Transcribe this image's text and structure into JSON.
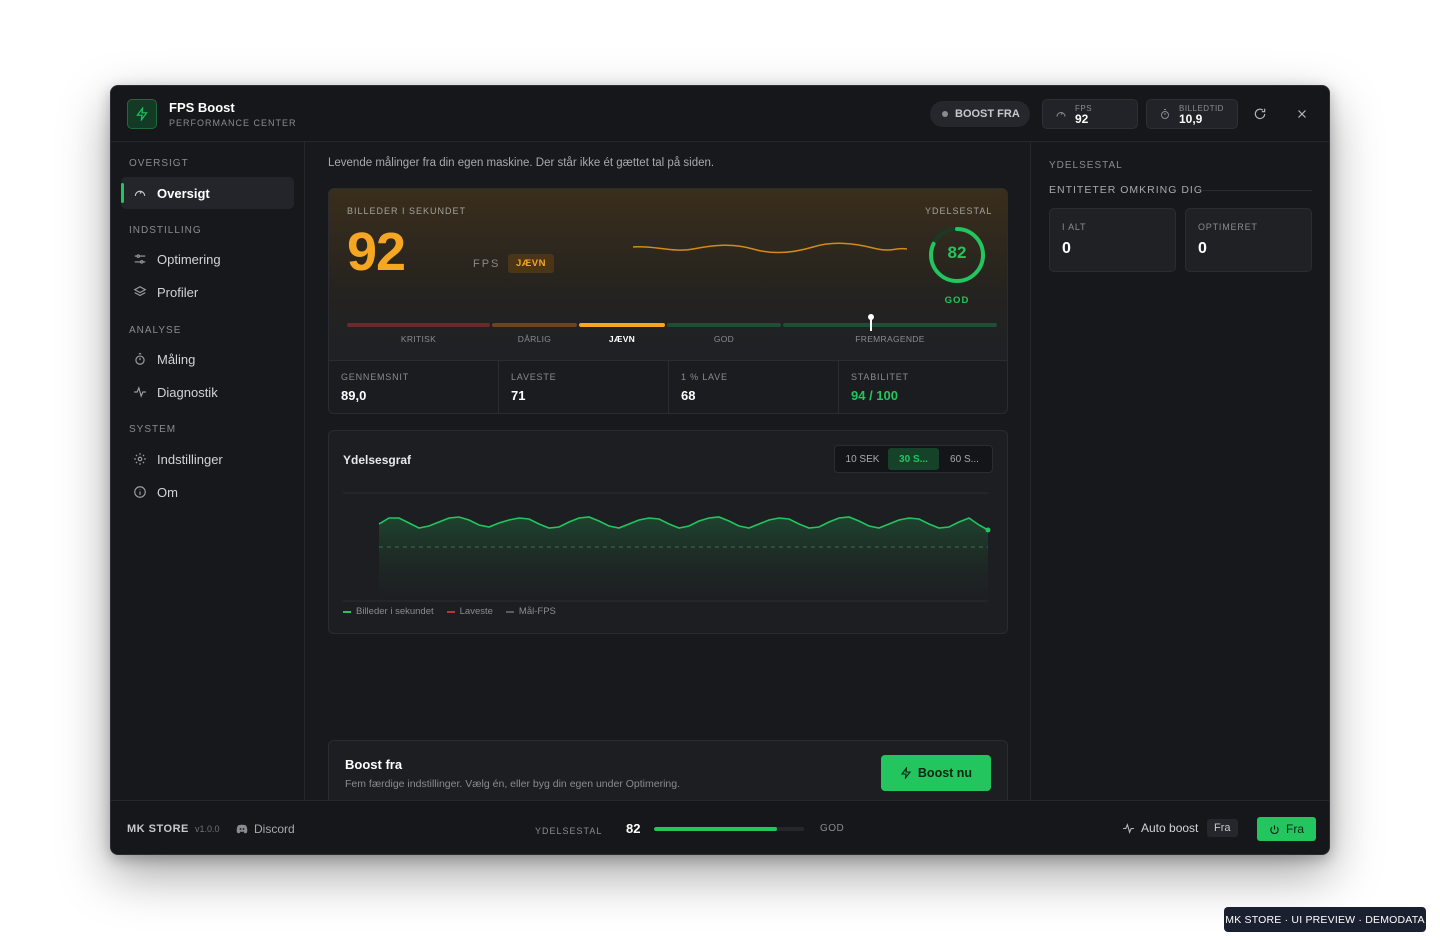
{
  "app": {
    "title": "FPS Boost",
    "subtitle": "PERFORMANCE CENTER",
    "boost_status": "BOOST FRA",
    "fps_label": "FPS",
    "fps_value": "92",
    "frametime_label": "BILLEDTID",
    "frametime_value": "10,9"
  },
  "sidebar": {
    "sections": [
      {
        "title": "OVERSIGT",
        "items": [
          {
            "label": "Oversigt",
            "icon": "gauge-icon",
            "active": true
          }
        ]
      },
      {
        "title": "INDSTILLING",
        "items": [
          {
            "label": "Optimering",
            "icon": "sliders-icon"
          },
          {
            "label": "Profiler",
            "icon": "layers-icon"
          }
        ]
      },
      {
        "title": "ANALYSE",
        "items": [
          {
            "label": "Måling",
            "icon": "stopwatch-icon"
          },
          {
            "label": "Diagnostik",
            "icon": "pulse-icon"
          }
        ]
      },
      {
        "title": "SYSTEM",
        "items": [
          {
            "label": "Indstillinger",
            "icon": "settings-icon"
          },
          {
            "label": "Om",
            "icon": "info-icon"
          }
        ]
      }
    ]
  },
  "main": {
    "intro": "Levende målinger fra din egen maskine. Der står ikke ét gættet tal på siden.",
    "hero": {
      "fps_label": "BILLEDER I SEKUNDET",
      "fps_value": "92",
      "fps_unit": "FPS",
      "tier": "JÆVN",
      "score_label": "YDELSESTAL",
      "score_value": "82",
      "score_fraction": 0.82,
      "score_status": "GOD",
      "scale": [
        {
          "label": "KRITISK",
          "color": "#6b2a2a"
        },
        {
          "label": "DÅRLIG",
          "color": "#6b4522"
        },
        {
          "label": "JÆVN",
          "color": "#f5a623",
          "current": true
        },
        {
          "label": "GOD",
          "color": "#1f4d35"
        },
        {
          "label": "FREMRAGENDE",
          "color": "#1f4d35"
        }
      ],
      "stats": [
        {
          "label": "GENNEMSNIT",
          "value": "89,0"
        },
        {
          "label": "LAVESTE",
          "value": "71"
        },
        {
          "label": "1 % LAVE",
          "value": "68"
        },
        {
          "label": "STABILITET",
          "value": "94 / 100",
          "color": "#22c55e"
        }
      ]
    },
    "graph": {
      "title": "Ydelsesgraf",
      "ranges": [
        {
          "label": "10 SEK"
        },
        {
          "label": "30 S...",
          "active": true
        },
        {
          "label": "60 S..."
        }
      ],
      "legend": [
        {
          "label": "Billeder i sekundet",
          "color": "#22c55e"
        },
        {
          "label": "Laveste",
          "color": "#b03a3a"
        },
        {
          "label": "Mål-FPS",
          "color": "#5a5b60"
        }
      ]
    },
    "boost": {
      "title": "Boost fra",
      "description": "Fem færdige indstillinger. Vælg én, eller byg din egen under Optimering.",
      "button": "Boost nu"
    }
  },
  "right_panel": {
    "label": "YDELSESTAL",
    "heading": "ENTITETER OMKRING DIG",
    "cards": [
      {
        "label": "I ALT",
        "value": "0"
      },
      {
        "label": "OPTIMERET",
        "value": "0"
      }
    ]
  },
  "statusbar": {
    "brand": "MK STORE",
    "version": "v1.0.0",
    "discord": "Discord",
    "perf_label": "YDELSESTAL",
    "perf_value": "82",
    "perf_fraction": 0.82,
    "perf_status": "GOD",
    "autoboost_label": "Auto boost",
    "autoboost_state": "Fra",
    "power_label": "Fra"
  },
  "watermark": "MK STORE · UI PREVIEW · DEMODATA",
  "colors": {
    "accent": "#22c55e",
    "warning": "#f5a623",
    "danger": "#b03a3a"
  }
}
